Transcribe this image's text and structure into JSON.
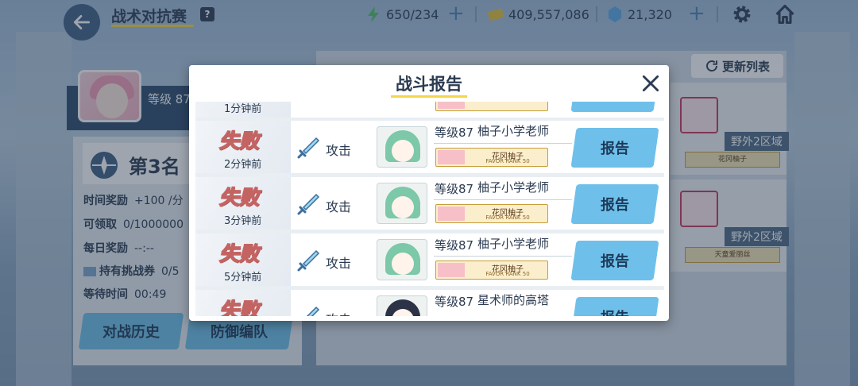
{
  "header": {
    "title": "战术对抗赛",
    "help": "?",
    "stamina": "650/234",
    "credits": "409,557,086",
    "gems": "21,320"
  },
  "player": {
    "level": "等级 87",
    "rank": "第3名",
    "stats": [
      {
        "label": "时间奖励",
        "value": "+100 /分"
      },
      {
        "label": "可领取",
        "value": "0/1000000"
      },
      {
        "label": "每日奖励",
        "value": "--:--"
      },
      {
        "label": "持有挑战券",
        "value": "0/5"
      },
      {
        "label": "等待时间",
        "value": "00:49"
      }
    ],
    "history_button": "对战历史",
    "defense_button": "防御编队"
  },
  "right_panel": {
    "refresh_label": "更新列表",
    "cards": [
      {
        "region": "野外2区域",
        "tag": "花冈柚子"
      },
      {
        "region": "野外2区域",
        "tag": "天童爱丽丝"
      }
    ]
  },
  "modal": {
    "title": "战斗报告",
    "top_partial_ago": "1分钟前",
    "rows": [
      {
        "result": "失败",
        "ago": "2分钟前",
        "action": "攻击",
        "level": "等级87",
        "name": "柚子小学老师",
        "tag": "花冈柚子",
        "rank": "FAVOR RANK 50",
        "button": "报告"
      },
      {
        "result": "失败",
        "ago": "3分钟前",
        "action": "攻击",
        "level": "等级87",
        "name": "柚子小学老师",
        "tag": "花冈柚子",
        "rank": "FAVOR RANK 50",
        "button": "报告"
      },
      {
        "result": "失败",
        "ago": "5分钟前",
        "action": "攻击",
        "level": "等级87",
        "name": "柚子小学老师",
        "tag": "花冈柚子",
        "rank": "FAVOR RANK 50",
        "button": "报告"
      },
      {
        "result": "失败",
        "ago": "",
        "action": "攻击",
        "level": "等级87",
        "name": "星术师的高塔",
        "tag": "",
        "rank": "",
        "button": "报告"
      }
    ]
  },
  "colors": {
    "accent_blue": "#6ec0ea",
    "title_underline": "#f3d64a",
    "defeat_outline": "#c46462",
    "text_dark": "#2b3b52"
  }
}
